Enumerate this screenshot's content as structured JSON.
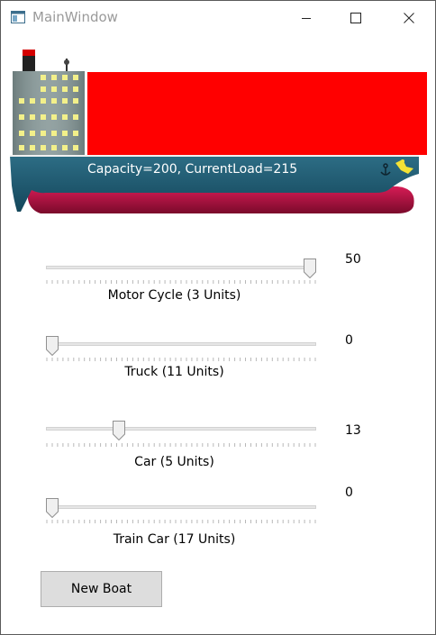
{
  "window": {
    "title": "MainWindow"
  },
  "ship": {
    "capacity_text": "Capacity=200, CurrentLoad=215",
    "cargo_color": "#ff0000",
    "hull_color": "#1f5b73",
    "keel_color": "#b2123f"
  },
  "sliders": [
    {
      "label": "Motor Cycle (3 Units)",
      "value": "50",
      "min": 0,
      "max": 50,
      "current": 50
    },
    {
      "label": "Truck (11 Units)",
      "value": "0",
      "min": 0,
      "max": 50,
      "current": 0
    },
    {
      "label": "Car (5 Units)",
      "value": "13",
      "min": 0,
      "max": 50,
      "current": 13
    },
    {
      "label": "Train Car (17 Units)",
      "value": "0",
      "min": 0,
      "max": 50,
      "current": 0
    }
  ],
  "buttons": {
    "new_boat": "New Boat"
  }
}
